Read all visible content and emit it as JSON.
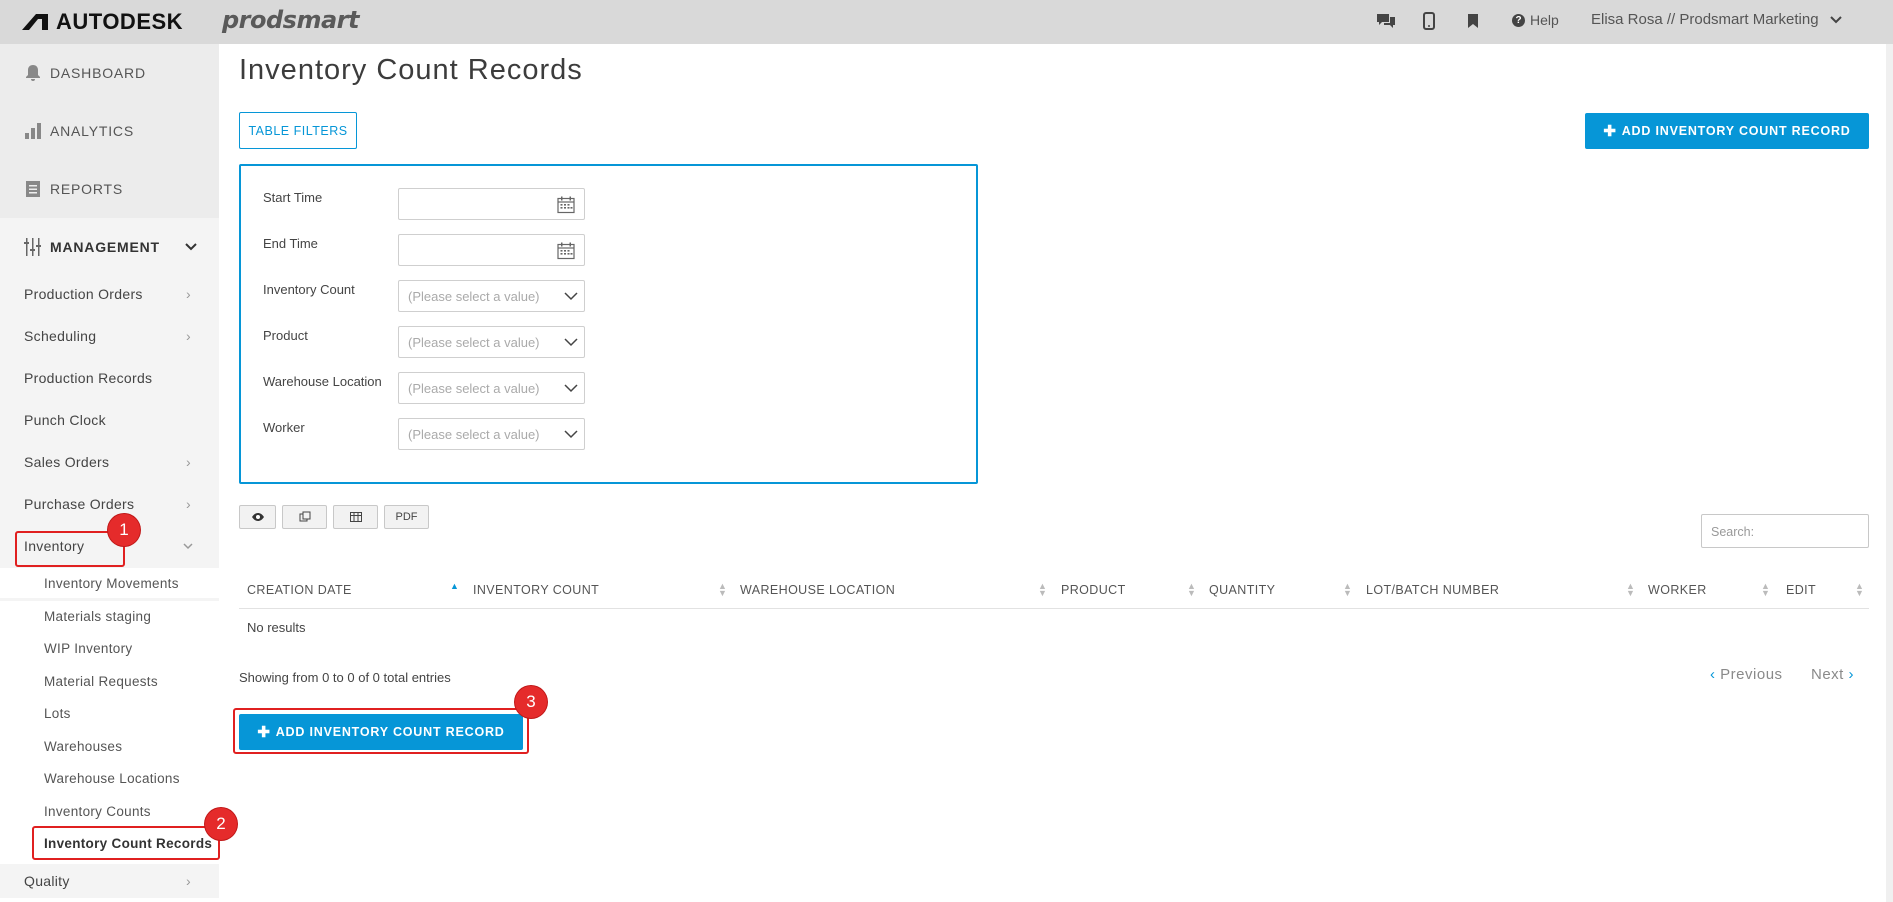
{
  "topbar": {
    "brand": "AUTODESK",
    "product": "prodsmart",
    "help_label": "Help",
    "user_label": "Elisa Rosa // Prodsmart Marketing",
    "icons": [
      "chat-icon",
      "mobile-icon",
      "bookmark-icon",
      "help-icon",
      "chevron-down-icon"
    ]
  },
  "sidebar": {
    "top_items": [
      {
        "label": "DASHBOARD",
        "icon": "bell-icon"
      },
      {
        "label": "ANALYTICS",
        "icon": "bar-chart-icon"
      },
      {
        "label": "REPORTS",
        "icon": "document-icon"
      },
      {
        "label": "MANAGEMENT",
        "icon": "sliders-icon"
      }
    ],
    "items": [
      {
        "label": "Production Orders"
      },
      {
        "label": "Scheduling"
      },
      {
        "label": "Production Records"
      },
      {
        "label": "Punch Clock"
      },
      {
        "label": "Sales Orders"
      },
      {
        "label": "Purchase Orders"
      },
      {
        "label": "Inventory"
      },
      {
        "label": "Quality"
      }
    ],
    "inventory_sub": [
      {
        "label": "Inventory Movements"
      },
      {
        "label": "Materials staging"
      },
      {
        "label": "WIP Inventory"
      },
      {
        "label": "Material Requests"
      },
      {
        "label": "Lots"
      },
      {
        "label": "Warehouses"
      },
      {
        "label": "Warehouse Locations"
      },
      {
        "label": "Inventory Counts"
      },
      {
        "label": "Inventory Count Records"
      }
    ]
  },
  "main": {
    "title": "Inventory Count Records",
    "table_filters_label": "TABLE FILTERS",
    "add_record_label": "ADD INVENTORY COUNT RECORD",
    "filters": {
      "start_time_label": "Start Time",
      "end_time_label": "End Time",
      "inventory_count_label": "Inventory Count",
      "product_label": "Product",
      "warehouse_location_label": "Warehouse Location",
      "worker_label": "Worker",
      "select_placeholder": "(Please select a value)"
    },
    "toolbar": {
      "pdf_label": "PDF"
    },
    "search_placeholder": "Search:",
    "columns": [
      "CREATION DATE",
      "INVENTORY COUNT",
      "WAREHOUSE LOCATION",
      "PRODUCT",
      "QUANTITY",
      "LOT/BATCH NUMBER",
      "WORKER",
      "EDIT"
    ],
    "no_results": "No results",
    "showing": "Showing from 0 to 0 of 0 total entries",
    "previous_label": "Previous",
    "next_label": "Next"
  },
  "annotations": [
    "1",
    "2",
    "3"
  ],
  "colors": {
    "accent": "#0696d7",
    "annotation": "#e52b2b",
    "topbar": "#d9d9d9",
    "sidebar": "#f4f4f4"
  }
}
